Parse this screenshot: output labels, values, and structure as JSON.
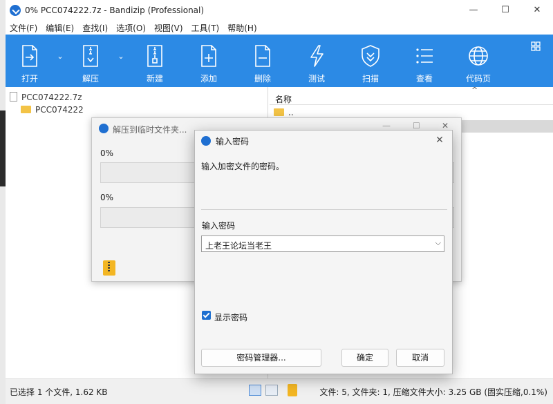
{
  "window": {
    "title": "0% PCC074222.7z - Bandizip (Professional)",
    "controls": {
      "minimize": "—",
      "maximize": "☐",
      "close": "✕"
    }
  },
  "menu": [
    "文件(F)",
    "编辑(E)",
    "查找(I)",
    "选项(O)",
    "视图(V)",
    "工具(T)",
    "帮助(H)"
  ],
  "toolbar": {
    "buttons": [
      {
        "id": "open",
        "label": "打开",
        "icon": "open-archive-icon"
      },
      {
        "id": "extract",
        "label": "解压",
        "icon": "extract-icon"
      },
      {
        "id": "new",
        "label": "新建",
        "icon": "new-archive-icon"
      },
      {
        "id": "add",
        "label": "添加",
        "icon": "add-icon"
      },
      {
        "id": "delete",
        "label": "删除",
        "icon": "delete-icon"
      },
      {
        "id": "test",
        "label": "测试",
        "icon": "test-icon"
      },
      {
        "id": "scan",
        "label": "扫描",
        "icon": "scan-shield-icon"
      },
      {
        "id": "view",
        "label": "查看",
        "icon": "view-list-icon"
      },
      {
        "id": "codepage",
        "label": "代码页",
        "icon": "codepage-globe-icon"
      }
    ],
    "accent_color": "#2c8ae5"
  },
  "tree": {
    "root": "PCC074222.7z",
    "child": "PCC074222"
  },
  "file_list": {
    "column_name": "名称",
    "sort_indicator": "^",
    "rows": [
      ".."
    ]
  },
  "status": {
    "left": "已选择 1 个文件, 1.62 KB",
    "right": "文件: 5, 文件夹: 1, 压缩文件大小: 3.25 GB (固实压缩,0.1%)"
  },
  "extract_dialog": {
    "title": "解压到临时文件夹...",
    "progress_1_text": "0%",
    "progress_1": 0,
    "progress_2_text": "0%",
    "progress_2": 0
  },
  "password_dialog": {
    "title": "输入密码",
    "close": "✕",
    "prompt": "输入加密文件的密码。",
    "field_label": "输入密码",
    "password_value": "上老王论坛当老王",
    "dropdown": "⌵",
    "show_password_label": "显示密码",
    "show_password_checked": true,
    "buttons": {
      "manager": "密码管理器...",
      "ok": "确定",
      "cancel": "取消"
    }
  }
}
